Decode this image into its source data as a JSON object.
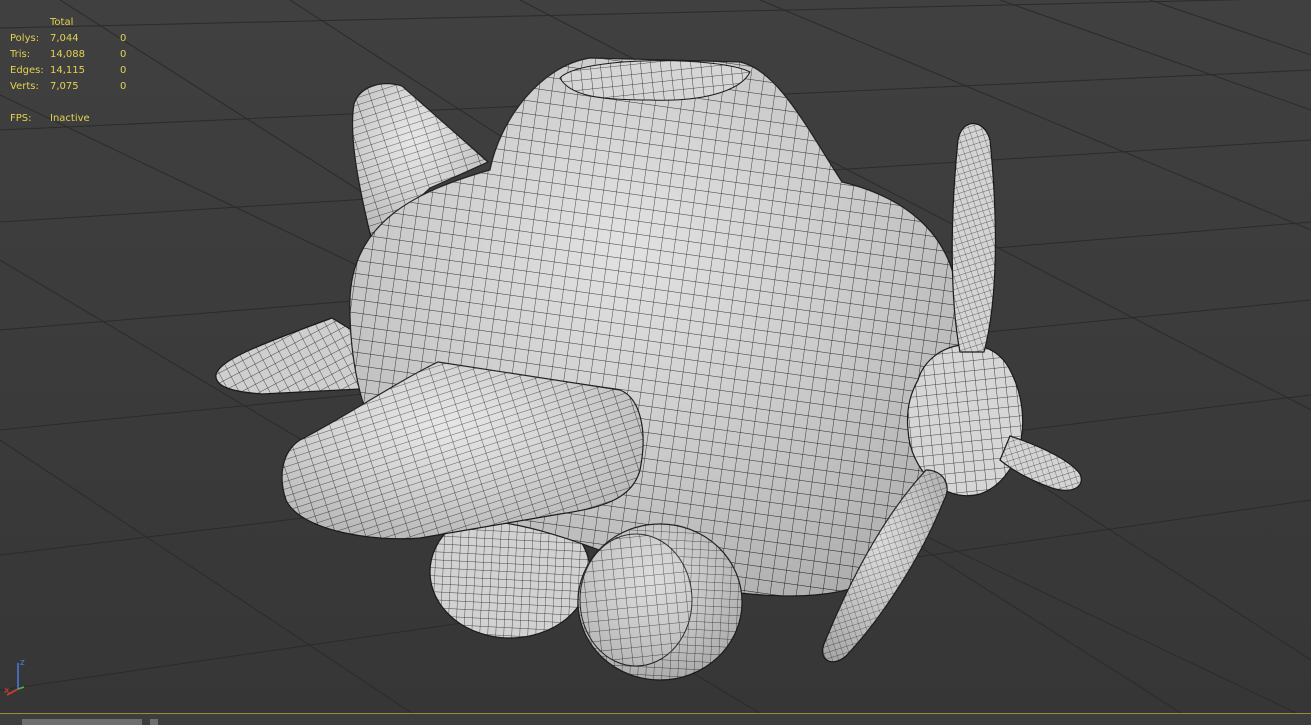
{
  "stats": {
    "header": "Total",
    "rows": [
      {
        "label": "Polys:",
        "total": "7,044",
        "selected": "0"
      },
      {
        "label": "Tris:",
        "total": "14,088",
        "selected": "0"
      },
      {
        "label": "Edges:",
        "total": "14,115",
        "selected": "0"
      },
      {
        "label": "Verts:",
        "total": "7,075",
        "selected": "0"
      }
    ],
    "fps_label": "FPS:",
    "fps_value": "Inactive"
  },
  "axis_tripod": {
    "z_label": "z",
    "x_label": "x"
  },
  "colors": {
    "viewport_bg": "#3c3c3c",
    "grid_line": "#2a2a2a",
    "stats_text": "#e3d24f",
    "mesh_fill": "#d8d8d8",
    "wire": "#1a1a1a",
    "axis_x": "#e0402e",
    "axis_y": "#3fbf3f",
    "axis_z": "#4a7de0"
  }
}
